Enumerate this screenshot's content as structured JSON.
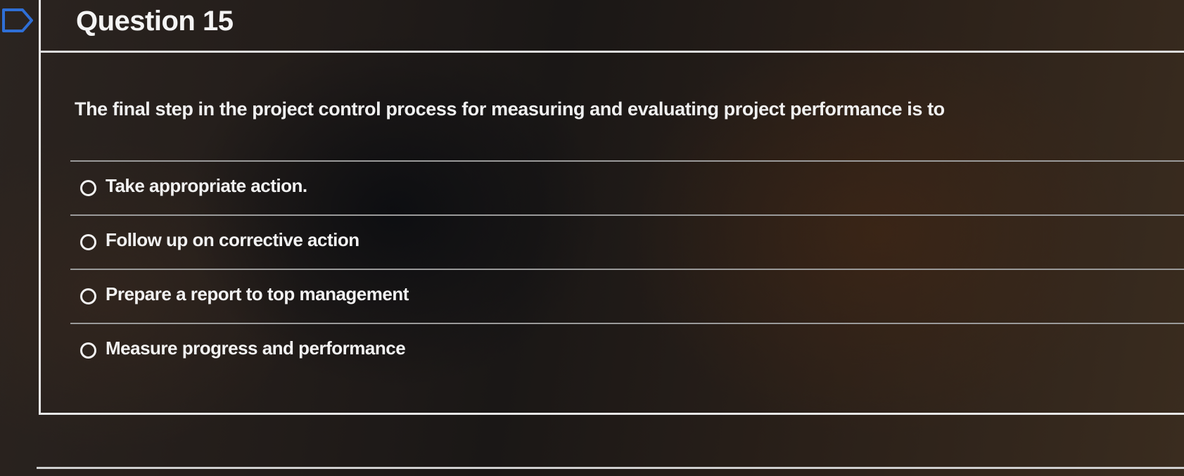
{
  "question": {
    "title": "Question 15",
    "text": "The final step in the project control process for measuring and evaluating project performance is to",
    "flag_icon": "flag-outline-icon"
  },
  "answers": [
    {
      "label": "Take appropriate action.",
      "selected": false
    },
    {
      "label": "Follow up on corrective action",
      "selected": false
    },
    {
      "label": "Prepare a report to top management",
      "selected": false
    },
    {
      "label": "Measure progress and performance",
      "selected": false
    }
  ],
  "colors": {
    "text": "#f2f2f2",
    "divider": "#9a9a9a",
    "border": "#e8e8e8",
    "flag": "#2f6fd6"
  }
}
